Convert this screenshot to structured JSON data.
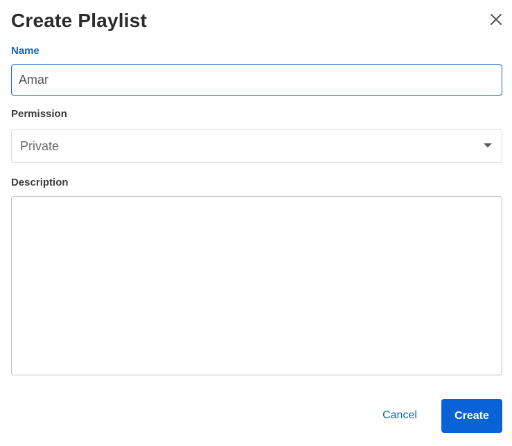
{
  "dialog": {
    "title": "Create Playlist",
    "close_icon": "close-icon"
  },
  "name_field": {
    "label": "Name",
    "value": "Amar",
    "focused": true
  },
  "permission_field": {
    "label": "Permission",
    "selected": "Private",
    "caret_icon": "caret-down-icon"
  },
  "description_field": {
    "label": "Description",
    "value": ""
  },
  "actions": {
    "cancel_label": "Cancel",
    "create_label": "Create"
  },
  "colors": {
    "accent": "#0a63d6",
    "title_text": "#2b2b2b",
    "label_text": "#3b3b3b"
  }
}
